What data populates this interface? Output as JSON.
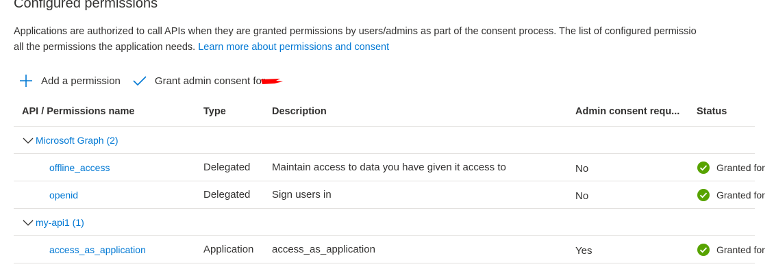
{
  "section": {
    "title": "Configured permissions",
    "intro_line1": "Applications are authorized to call APIs when they are granted permissions by users/admins as part of the consent process. The list of configured permissio",
    "intro_line2": "all the permissions the application needs.",
    "learn_more_link": "Learn more about permissions and consent"
  },
  "toolbar": {
    "add_permission_label": "Add a permission",
    "grant_consent_label": "Grant admin consent for",
    "add_icon": "plus-icon",
    "grant_icon": "checkmark-icon"
  },
  "table": {
    "columns": {
      "name": "API / Permissions name",
      "type": "Type",
      "description": "Description",
      "admin_consent": "Admin consent requ...",
      "status": "Status"
    },
    "groups": [
      {
        "label": "Microsoft Graph (2)",
        "rows": [
          {
            "name": "offline_access",
            "type": "Delegated",
            "description": "Maintain access to data you have given it access to",
            "admin_consent": "No",
            "status": "Granted for"
          },
          {
            "name": "openid",
            "type": "Delegated",
            "description": "Sign users in",
            "admin_consent": "No",
            "status": "Granted for"
          }
        ]
      },
      {
        "label": "my-api1 (1)",
        "rows": [
          {
            "name": "access_as_application",
            "type": "Application",
            "description": "access_as_application",
            "admin_consent": "Yes",
            "status": "Granted for"
          }
        ]
      }
    ]
  },
  "colors": {
    "link": "#0078d4",
    "success": "#57a300",
    "divider": "#e1dfdd",
    "redaction": "#ff0000"
  }
}
